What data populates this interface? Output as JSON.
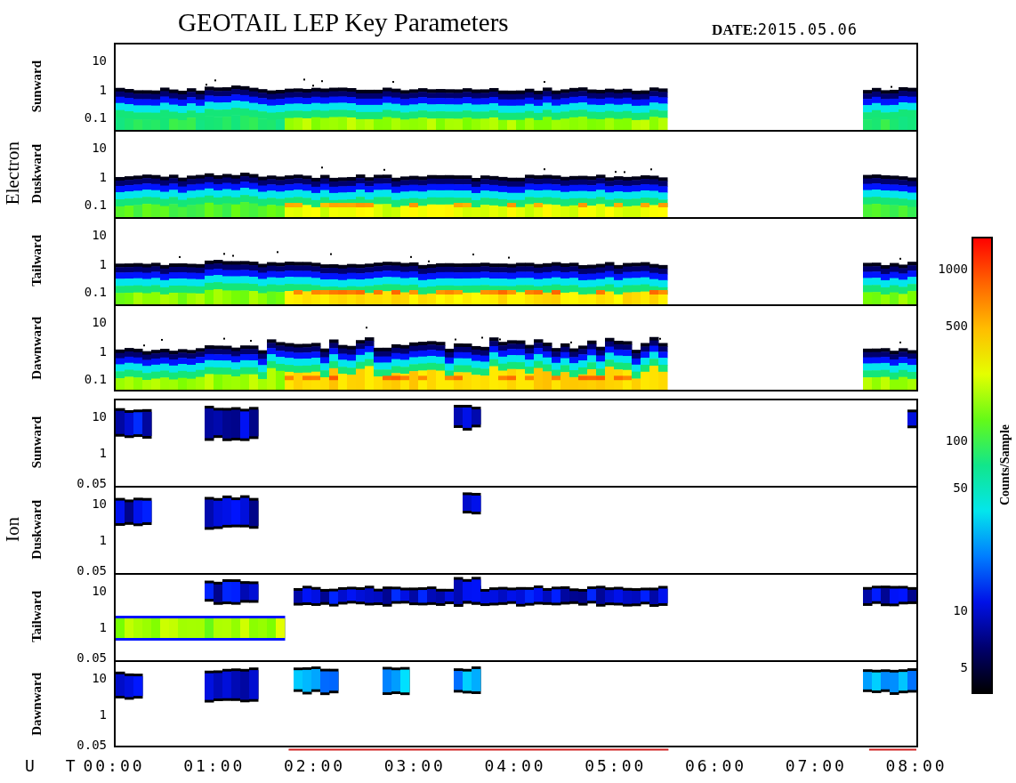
{
  "title": "GEOTAIL LEP Key Parameters",
  "date": {
    "label": "DATE:",
    "value": "2015.05.06"
  },
  "groups": [
    {
      "label": "Electron",
      "kind": "electron",
      "panels": [
        {
          "label": "Sunward",
          "yticks": [
            "10",
            "1",
            "0.1"
          ]
        },
        {
          "label": "Duskward",
          "yticks": [
            "10",
            "1",
            "0.1"
          ]
        },
        {
          "label": "Tailward",
          "yticks": [
            "10",
            "1",
            "0.1"
          ]
        },
        {
          "label": "Dawnward",
          "yticks": [
            "10",
            "1",
            "0.1"
          ]
        }
      ]
    },
    {
      "label": "Ion",
      "kind": "ion",
      "panels": [
        {
          "label": "Sunward",
          "yticks": [
            "10",
            "1",
            "0.05"
          ]
        },
        {
          "label": "Duskward",
          "yticks": [
            "10",
            "1",
            "0.05"
          ]
        },
        {
          "label": "Tailward",
          "yticks": [
            "10",
            "1",
            "0.05"
          ]
        },
        {
          "label": "Dawnward",
          "yticks": [
            "10",
            "1",
            "0.05"
          ]
        }
      ]
    }
  ],
  "xaxis": {
    "label": "U T",
    "ticks": [
      "00:00",
      "01:00",
      "02:00",
      "03:00",
      "04:00",
      "05:00",
      "06:00",
      "07:00",
      "08:00"
    ]
  },
  "colorbar": {
    "label": "Counts/Sample",
    "ticks": [
      "1000",
      "500",
      "100",
      "50",
      "10",
      "5"
    ]
  }
}
